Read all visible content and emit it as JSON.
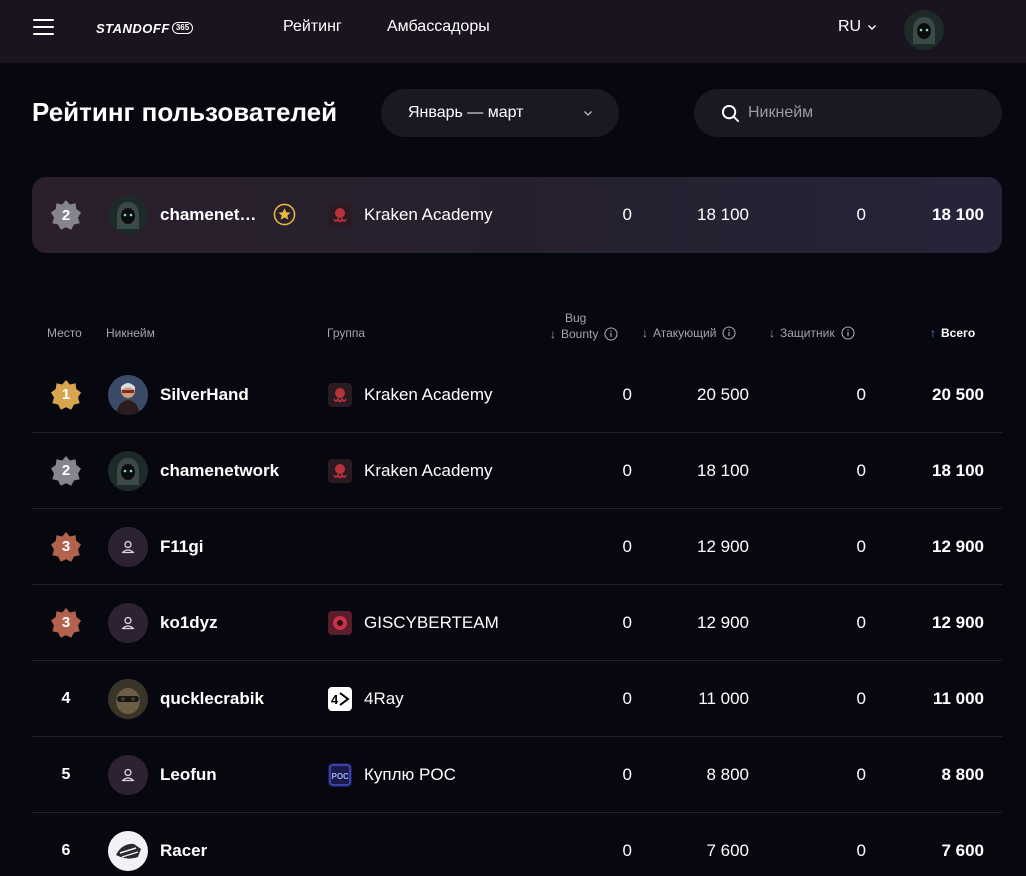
{
  "header": {
    "logo_text": "STANDOFF",
    "logo_badge": "365",
    "nav": [
      "Рейтинг",
      "Амбассадоры"
    ],
    "language": "RU"
  },
  "page": {
    "title": "Рейтинг пользователей",
    "period": "Январь — март",
    "search_placeholder": "Никнейм"
  },
  "my_card": {
    "rank": "2",
    "nick": "chamenet…",
    "group": "Kraken Academy",
    "bug_bounty": "0",
    "attacker": "18 100",
    "defender": "0",
    "total": "18 100"
  },
  "table": {
    "headers": {
      "place": "Место",
      "nick": "Никнейм",
      "group": "Группа",
      "bug_top": "Bug",
      "bug_bottom": "Bounty",
      "attacker": "Атакующий",
      "defender": "Защитник",
      "total": "Всего"
    },
    "rows": [
      {
        "rank": "1",
        "nick": "SilverHand",
        "group": "Kraken Academy",
        "bug_bounty": "0",
        "attacker": "20 500",
        "defender": "0",
        "total": "20 500"
      },
      {
        "rank": "2",
        "nick": "chamenetwork",
        "group": "Kraken Academy",
        "bug_bounty": "0",
        "attacker": "18 100",
        "defender": "0",
        "total": "18 100"
      },
      {
        "rank": "3",
        "nick": "F11gi",
        "group": "",
        "bug_bounty": "0",
        "attacker": "12 900",
        "defender": "0",
        "total": "12 900"
      },
      {
        "rank": "3",
        "nick": "ko1dyz",
        "group": "GISCYBERTEAM",
        "bug_bounty": "0",
        "attacker": "12 900",
        "defender": "0",
        "total": "12 900"
      },
      {
        "rank": "4",
        "nick": "qucklecrabik",
        "group": "4Ray",
        "bug_bounty": "0",
        "attacker": "11 000",
        "defender": "0",
        "total": "11 000"
      },
      {
        "rank": "5",
        "nick": "Leofun",
        "group": "Куплю POC",
        "bug_bounty": "0",
        "attacker": "8 800",
        "defender": "0",
        "total": "8 800"
      },
      {
        "rank": "6",
        "nick": "Racer",
        "group": "",
        "bug_bounty": "0",
        "attacker": "7 600",
        "defender": "0",
        "total": "7 600"
      }
    ]
  },
  "icons": {
    "medal_gold": "#d7a54e",
    "medal_silver": "#86848f",
    "medal_bronze": "#b3624e",
    "accent": "#5a8cff"
  }
}
